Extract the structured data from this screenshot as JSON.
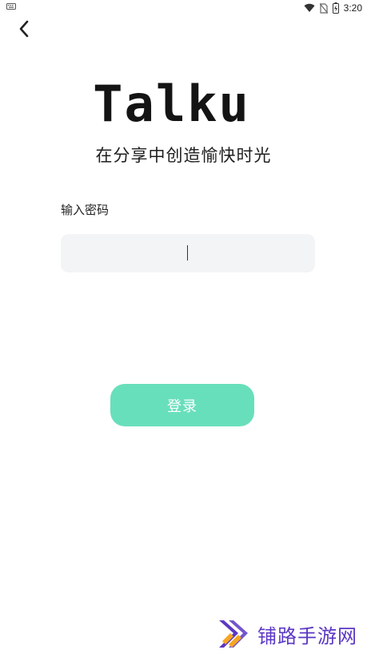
{
  "status_bar": {
    "time": "3:20",
    "left_icon": "keyboard-icon",
    "right_icons": [
      "wifi-icon",
      "no-sim-icon",
      "battery-charging-icon"
    ]
  },
  "nav": {
    "back_icon": "chevron-left-icon"
  },
  "header": {
    "logo_text": "Talku",
    "tagline": "在分享中创造愉快时光"
  },
  "form": {
    "password_label": "输入密码",
    "password_value": "",
    "password_placeholder": ""
  },
  "actions": {
    "login_label": "登录"
  },
  "watermark": {
    "text": "铺路手游网"
  },
  "colors": {
    "accent": "#68dfbb",
    "input_bg": "#f3f4f6",
    "watermark_purple": "#5b37c4",
    "watermark_orange": "#f6a623"
  }
}
